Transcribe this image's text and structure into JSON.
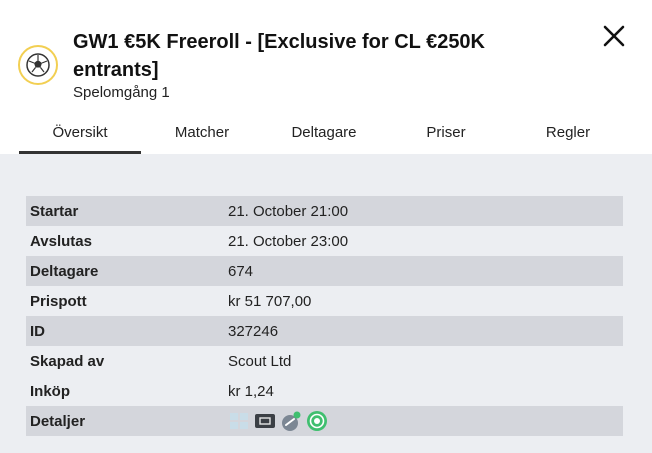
{
  "header": {
    "title": "GW1 €5K Freeroll - [Exclusive for CL €250K entrants]",
    "subtitle": "Spelomgång 1",
    "logo_icon": "soccer-ball-icon",
    "close_icon": "close-icon"
  },
  "tabs": [
    {
      "label": "Översikt",
      "active": true
    },
    {
      "label": "Matcher",
      "active": false
    },
    {
      "label": "Deltagare",
      "active": false
    },
    {
      "label": "Priser",
      "active": false
    },
    {
      "label": "Regler",
      "active": false
    }
  ],
  "details": [
    {
      "key": "Startar",
      "value": "21. October 21:00"
    },
    {
      "key": "Avslutas",
      "value": "21. October 23:00"
    },
    {
      "key": "Deltagare",
      "value": "674"
    },
    {
      "key": "Prispott",
      "value": "kr 51 707,00"
    },
    {
      "key": "ID",
      "value": "327246"
    },
    {
      "key": "Skapad av",
      "value": "Scout Ltd"
    },
    {
      "key": "Inköp",
      "value": "kr 1,24"
    },
    {
      "key": "Detaljer",
      "value": ""
    }
  ],
  "detail_icons": [
    "grid-icon",
    "screen-icon",
    "link-badge-icon",
    "target-icon"
  ],
  "colors": {
    "accent_yellow": "#f2cf52",
    "content_bg": "#eceef2",
    "row_shaded": "#d4d6dc",
    "target_green": "#3fbf6f"
  }
}
